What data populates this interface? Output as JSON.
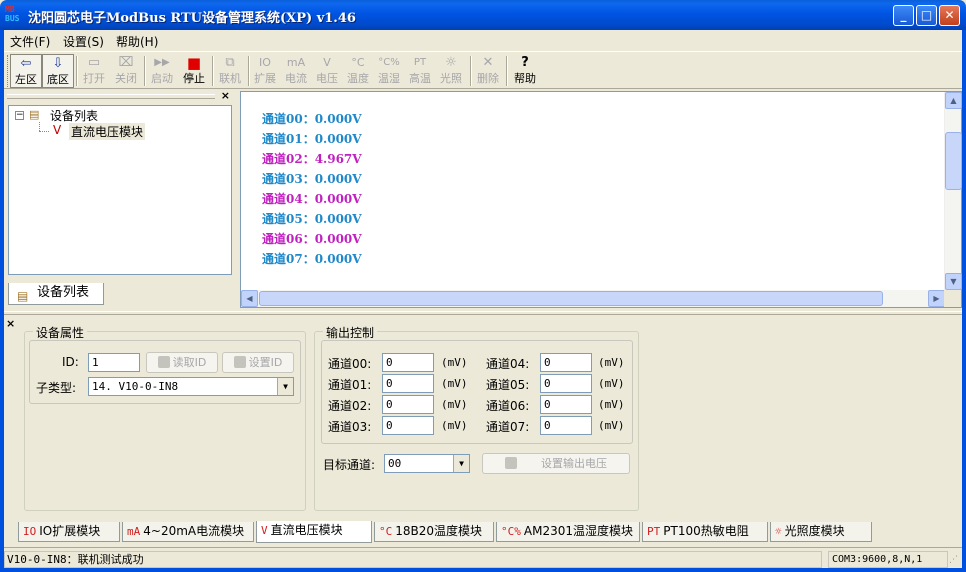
{
  "window": {
    "title": "沈阳圆芯电子ModBus RTU设备管理系统(XP) v1.46",
    "icon_top": "MB",
    "icon_bottom": "BUS",
    "minimize": "_",
    "maximize": "□",
    "close": "✕"
  },
  "menu": [
    {
      "label": "文件(F)"
    },
    {
      "label": "设置(S)"
    },
    {
      "label": "帮助(H)"
    }
  ],
  "toolbar": [
    {
      "label": "左区",
      "icon": "⇦",
      "enabled": true,
      "pressed": true
    },
    {
      "label": "底区",
      "icon": "⇩",
      "enabled": true,
      "pressed": true
    },
    {
      "label": "打开",
      "icon": "▭",
      "enabled": false
    },
    {
      "label": "关闭",
      "icon": "⌧",
      "enabled": false
    },
    {
      "label": "启动",
      "icon": "▶▶",
      "enabled": false
    },
    {
      "label": "停止",
      "icon": "■",
      "enabled": true
    },
    {
      "label": "联机",
      "icon": "⧉",
      "enabled": false
    },
    {
      "label": "扩展",
      "icon": "IO",
      "enabled": false
    },
    {
      "label": "电流",
      "icon": "mA",
      "enabled": false
    },
    {
      "label": "电压",
      "icon": "V",
      "enabled": false
    },
    {
      "label": "温度",
      "icon": "°C",
      "enabled": false
    },
    {
      "label": "温湿",
      "icon": "°C%",
      "enabled": false
    },
    {
      "label": "高温",
      "icon": "PT",
      "enabled": false
    },
    {
      "label": "光照",
      "icon": "☼",
      "enabled": false
    },
    {
      "label": "删除",
      "icon": "✕",
      "enabled": false
    },
    {
      "label": "帮助",
      "icon": "?",
      "enabled": true
    }
  ],
  "device_panel": {
    "close": "×",
    "tree_root": "设备列表",
    "tree_child": "直流电压模块",
    "tree_child_icon": "V",
    "tab_label": "设备列表"
  },
  "channels": [
    {
      "label": "通道00：0.000V",
      "color": "#1E88C8"
    },
    {
      "label": "通道01：0.000V",
      "color": "#1E88C8"
    },
    {
      "label": "通道02：4.967V",
      "color": "#C020C0"
    },
    {
      "label": "通道03：0.000V",
      "color": "#1E88C8"
    },
    {
      "label": "通道04：0.000V",
      "color": "#C020C0"
    },
    {
      "label": "通道05：0.000V",
      "color": "#1E88C8"
    },
    {
      "label": "通道06：0.000V",
      "color": "#C020C0"
    },
    {
      "label": "通道07：0.000V",
      "color": "#1E88C8"
    }
  ],
  "device_props": {
    "title": "设备属性",
    "id_label": "ID:",
    "id_value": "1",
    "read_id": "读取ID",
    "set_id": "设置ID",
    "subtype_label": "子类型:",
    "subtype_value": "14. V10-0-IN8"
  },
  "output_control": {
    "title": "输出控制",
    "unit": "(mV)",
    "channels": [
      {
        "label": "通道00:",
        "value": "0"
      },
      {
        "label": "通道01:",
        "value": "0"
      },
      {
        "label": "通道02:",
        "value": "0"
      },
      {
        "label": "通道03:",
        "value": "0"
      },
      {
        "label": "通道04:",
        "value": "0"
      },
      {
        "label": "通道05:",
        "value": "0"
      },
      {
        "label": "通道06:",
        "value": "0"
      },
      {
        "label": "通道07:",
        "value": "0"
      }
    ],
    "target_label": "目标通道:",
    "target_value": "00",
    "set_button": "设置输出电压"
  },
  "module_tabs": [
    {
      "icon": "IO",
      "label": "IO扩展模块"
    },
    {
      "icon": "mA",
      "label": "4~20mA电流模块"
    },
    {
      "icon": "V",
      "label": "直流电压模块",
      "active": true
    },
    {
      "icon": "°C",
      "label": "18B20温度模块"
    },
    {
      "icon": "°C%",
      "label": "AM2301温湿度模块"
    },
    {
      "icon": "PT",
      "label": "PT100热敏电阻"
    },
    {
      "icon": "☼",
      "label": "光照度模块"
    }
  ],
  "status": {
    "message": "V10-0-IN8：联机测试成功",
    "port": "COM3:9600,8,N,1"
  }
}
